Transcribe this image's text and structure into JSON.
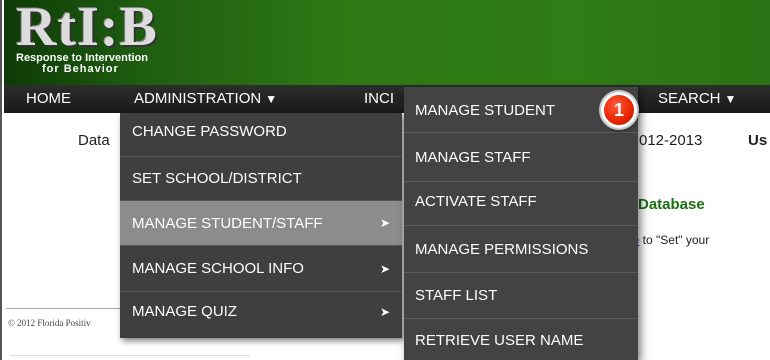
{
  "header": {
    "logo_main": "RtI:B",
    "logo_sub_line1": "Response to Intervention",
    "logo_sub_line2": "for Behavior"
  },
  "nav": {
    "home": "HOME",
    "administration": "ADMINISTRATION",
    "incidents_partial": "INCI",
    "search": "SEARCH",
    "caret": "▼"
  },
  "background": {
    "data_partial": "Data",
    "year_partial": "012-2013",
    "user_partial": "Us",
    "db_title": "Database",
    "set_here_link": "ere",
    "set_here_rest": " to \"Set\" your",
    "copyright": "© 2012 Florida Positiv"
  },
  "admin_menu": {
    "items": [
      {
        "label": "CHANGE PASSWORD",
        "has_submenu": false
      },
      {
        "label": "SET SCHOOL/DISTRICT",
        "has_submenu": false
      },
      {
        "label": "MANAGE STUDENT/STAFF",
        "has_submenu": true,
        "active": true
      },
      {
        "label": "MANAGE SCHOOL INFO",
        "has_submenu": true
      },
      {
        "label": "MANAGE QUIZ",
        "has_submenu": true
      }
    ],
    "arrow": "➤"
  },
  "sub_menu": {
    "items": [
      {
        "label": "MANAGE STUDENT"
      },
      {
        "label": "MANAGE STAFF"
      },
      {
        "label": "ACTIVATE STAFF"
      },
      {
        "label": "MANAGE PERMISSIONS"
      },
      {
        "label": "STAFF LIST"
      },
      {
        "label": "RETRIEVE USER NAME"
      }
    ]
  },
  "callout": {
    "number": "1"
  },
  "colors": {
    "header_green": "#2e7a15",
    "nav_black": "#1a1a1a",
    "menu_gray": "#3f3f3f",
    "menu_active": "#8c8c8c",
    "db_title_green": "#1b6e12",
    "link_blue": "#1a3fc4",
    "badge_red": "#e62400"
  }
}
